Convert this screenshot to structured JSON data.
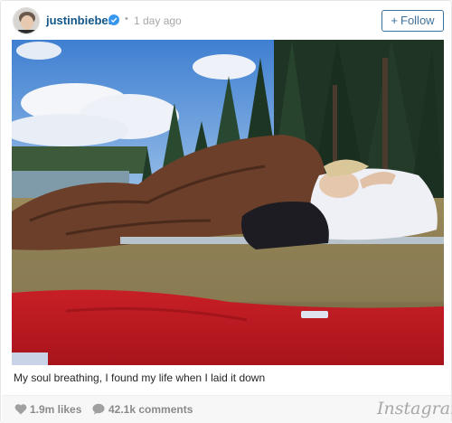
{
  "header": {
    "username": "justinbieber",
    "time_ago": "1 day ago",
    "follow_label": "Follow",
    "verified_color": "#3897f0"
  },
  "post": {
    "caption": "My soul breathing, I found my life when I laid it down"
  },
  "footer": {
    "likes": "1.9m likes",
    "comments": "42.1k comments",
    "brand": "Instagram"
  },
  "colors": {
    "username": "#125688",
    "follow": "#3f729b",
    "meta": "#a5a7aa"
  },
  "icons": [
    "avatar",
    "verified-badge-icon",
    "heart-icon",
    "comment-bubble-icon"
  ]
}
